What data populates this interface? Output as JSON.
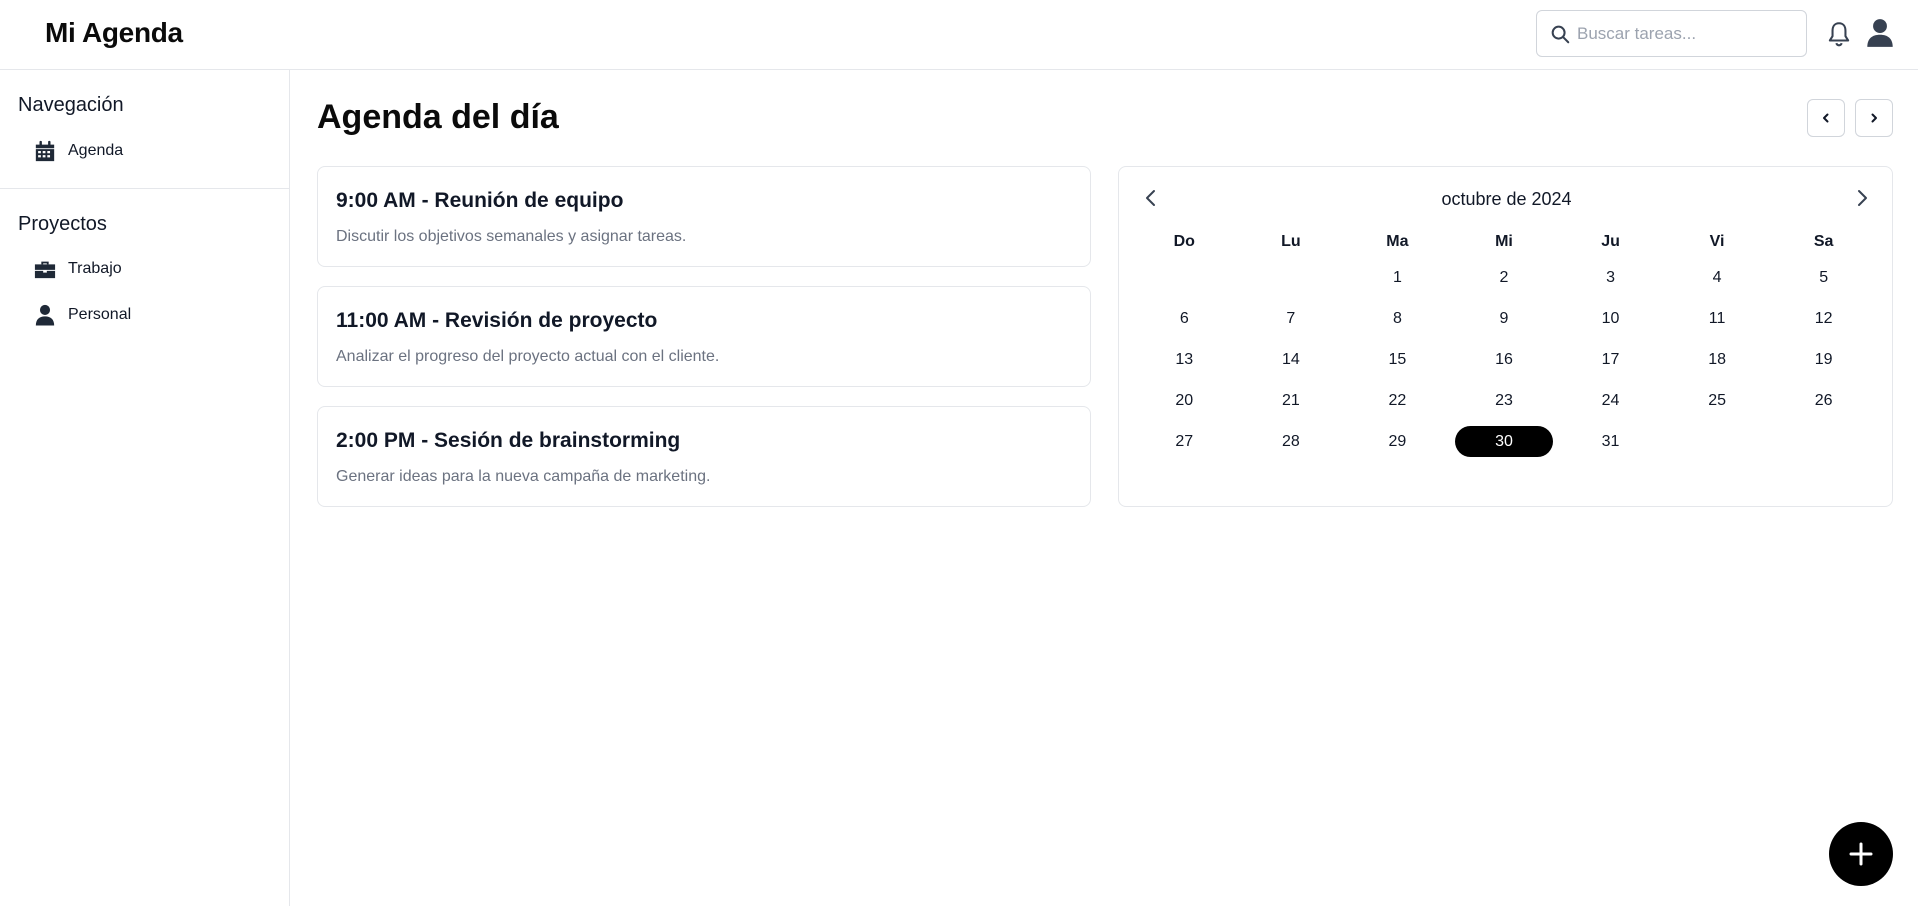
{
  "app": {
    "title": "Mi Agenda"
  },
  "search": {
    "placeholder": "Buscar tareas...",
    "value": ""
  },
  "header_icons": [
    "search-icon",
    "bell-icon",
    "user-icon"
  ],
  "sidebar": {
    "navigation_heading": "Navegación",
    "navigation_items": [
      {
        "label": "Agenda",
        "icon": "calendar-icon"
      }
    ],
    "projects_heading": "Proyectos",
    "project_items": [
      {
        "label": "Trabajo",
        "icon": "briefcase-icon"
      },
      {
        "label": "Personal",
        "icon": "user-icon"
      }
    ]
  },
  "main": {
    "title": "Agenda del día",
    "events": [
      {
        "title": "9:00 AM - Reunión de equipo",
        "description": "Discutir los objetivos semanales y asignar tareas."
      },
      {
        "title": "11:00 AM - Revisión de proyecto",
        "description": "Analizar el progreso del proyecto actual con el cliente."
      },
      {
        "title": "2:00 PM - Sesión de brainstorming",
        "description": "Generar ideas para la nueva campaña de marketing."
      }
    ]
  },
  "calendar": {
    "month_label": "octubre de 2024",
    "weekdays": [
      "Do",
      "Lu",
      "Ma",
      "Mi",
      "Ju",
      "Vi",
      "Sa"
    ],
    "weeks": [
      [
        "",
        "",
        "1",
        "2",
        "3",
        "4",
        "5"
      ],
      [
        "6",
        "7",
        "8",
        "9",
        "10",
        "11",
        "12"
      ],
      [
        "13",
        "14",
        "15",
        "16",
        "17",
        "18",
        "19"
      ],
      [
        "20",
        "21",
        "22",
        "23",
        "24",
        "25",
        "26"
      ],
      [
        "27",
        "28",
        "29",
        "30",
        "31",
        "",
        ""
      ]
    ],
    "selected_day": "30"
  },
  "colors": {
    "accent": "#000000",
    "border": "#e5e7eb",
    "muted_text": "#6b7280",
    "icon": "#374151"
  }
}
